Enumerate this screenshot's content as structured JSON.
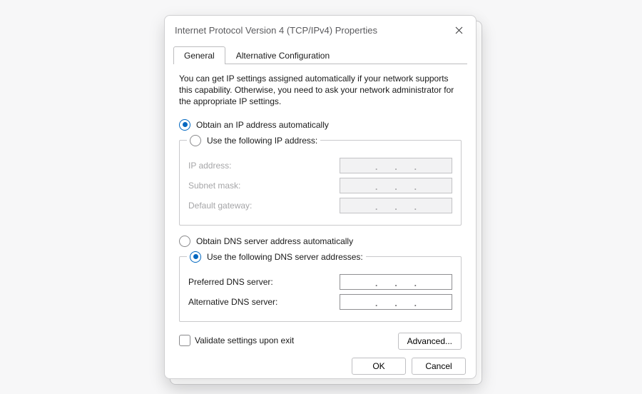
{
  "title": "Internet Protocol Version 4 (TCP/IPv4) Properties",
  "tabs": {
    "general": "General",
    "alt": "Alternative Configuration"
  },
  "description": "You can get IP settings assigned automatically if your network supports this capability. Otherwise, you need to ask your network administrator for the appropriate IP settings.",
  "ip": {
    "auto_label": "Obtain an IP address automatically",
    "manual_label": "Use the following IP address:",
    "selected": "auto",
    "fields": {
      "ip_address": "IP address:",
      "subnet_mask": "Subnet mask:",
      "default_gateway": "Default gateway:"
    }
  },
  "dns": {
    "auto_label": "Obtain DNS server address automatically",
    "manual_label": "Use the following DNS server addresses:",
    "selected": "manual",
    "fields": {
      "preferred": "Preferred DNS server:",
      "alternate": "Alternative DNS server:"
    }
  },
  "validate_label": "Validate settings upon exit",
  "validate_checked": false,
  "buttons": {
    "advanced": "Advanced...",
    "ok": "OK",
    "cancel": "Cancel"
  }
}
